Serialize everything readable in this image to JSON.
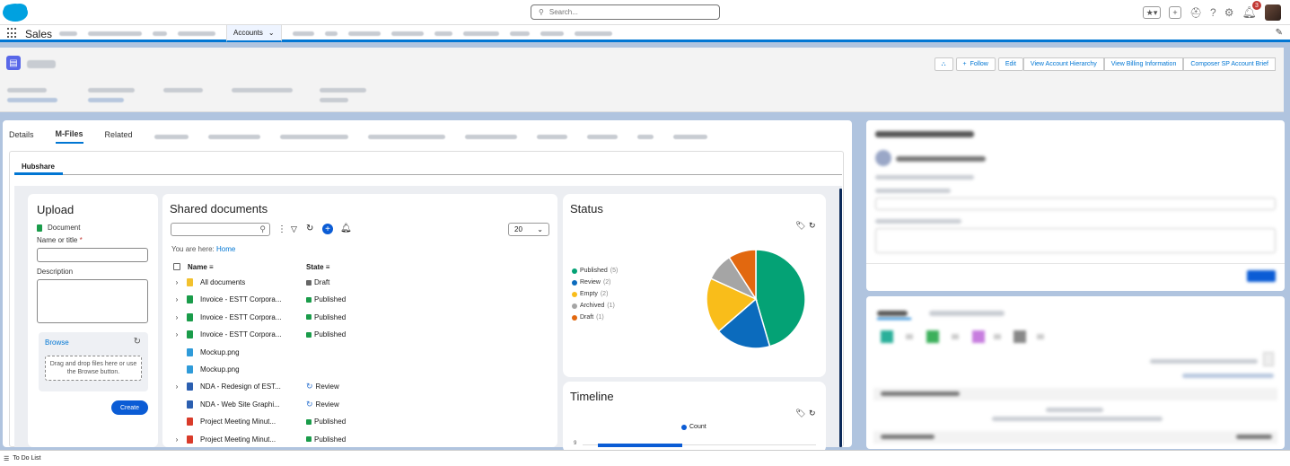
{
  "topbar": {
    "search_placeholder": "Search...",
    "notification_count": "3"
  },
  "nav": {
    "app_name": "Sales",
    "active_tab": "Accounts"
  },
  "header": {
    "actions": [
      "Follow",
      "Edit",
      "View Account Hierarchy",
      "View Billing Information",
      "Composer SP Account Brief"
    ]
  },
  "record_tabs": [
    "Details",
    "M-Files",
    "Related"
  ],
  "hubshare": {
    "tab": "Hubshare"
  },
  "upload": {
    "title": "Upload",
    "doc_type": "Document",
    "name_label": "Name or title",
    "required_mark": "*",
    "description_label": "Description",
    "browse": "Browse",
    "drop_text": "Drag and drop files here or use the Browse button.",
    "create": "Create"
  },
  "shared": {
    "title": "Shared documents",
    "page_size": "20",
    "breadcrumb_prefix": "You are here:",
    "breadcrumb_link": "Home",
    "col_name": "Name",
    "col_state": "State",
    "rows": [
      {
        "name": "All documents",
        "state": "Draft"
      },
      {
        "name": "Invoice - ESTT Corpora...",
        "state": "Published"
      },
      {
        "name": "Invoice - ESTT Corpora...",
        "state": "Published"
      },
      {
        "name": "Invoice - ESTT Corpora...",
        "state": "Published"
      },
      {
        "name": "Mockup.png",
        "state": ""
      },
      {
        "name": "Mockup.png",
        "state": ""
      },
      {
        "name": "NDA - Redesign of EST...",
        "state": "Review"
      },
      {
        "name": "NDA - Web Site Graphi...",
        "state": "Review"
      },
      {
        "name": "Project Meeting Minut...",
        "state": "Published"
      },
      {
        "name": "Project Meeting Minut...",
        "state": "Published"
      }
    ]
  },
  "status": {
    "title": "Status",
    "legend": [
      {
        "label": "Published",
        "count": "(5)",
        "color": "#04a275"
      },
      {
        "label": "Review",
        "count": "(2)",
        "color": "#0b6bbd"
      },
      {
        "label": "Empty",
        "count": "(2)",
        "color": "#f9bd1a"
      },
      {
        "label": "Archived",
        "count": "(1)",
        "color": "#a5a5a5"
      },
      {
        "label": "Draft",
        "count": "(1)",
        "color": "#e2680f"
      }
    ]
  },
  "timeline": {
    "title": "Timeline",
    "legend": "Count",
    "y_tick": "9"
  },
  "chart_data": {
    "type": "pie",
    "categories": [
      "Published",
      "Review",
      "Empty",
      "Archived",
      "Draft"
    ],
    "values": [
      5,
      2,
      2,
      1,
      1
    ],
    "colors": [
      "#04a275",
      "#0b6bbd",
      "#f9bd1a",
      "#a5a5a5",
      "#e2680f"
    ]
  },
  "bottom": {
    "label": "To Do List"
  }
}
